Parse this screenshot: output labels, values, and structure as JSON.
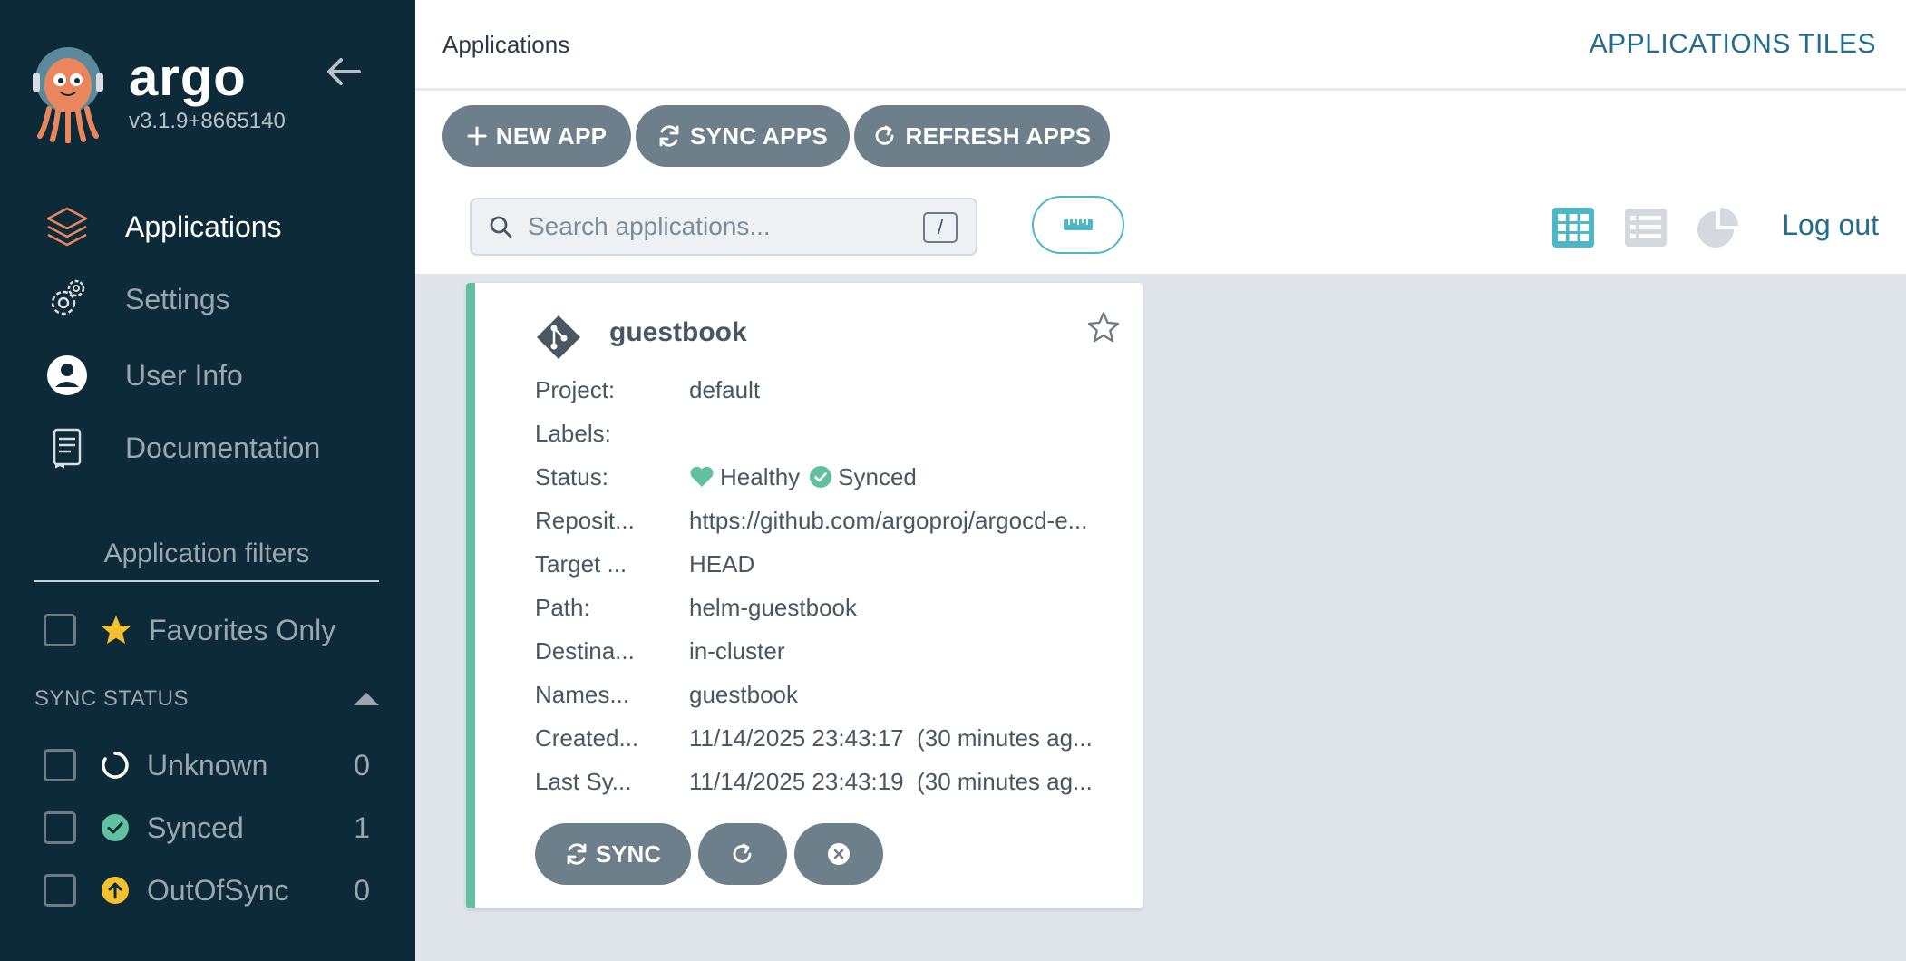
{
  "sidebar": {
    "brand": "argo",
    "version": "v3.1.9+8665140",
    "nav": [
      {
        "label": "Applications",
        "icon": "layers-icon",
        "active": true
      },
      {
        "label": "Settings",
        "icon": "gears-icon",
        "active": false
      },
      {
        "label": "User Info",
        "icon": "user-circle-icon",
        "active": false
      },
      {
        "label": "Documentation",
        "icon": "book-icon",
        "active": false
      }
    ],
    "filters_title": "Application filters",
    "favorites_label": "Favorites Only",
    "sync_status_title": "SYNC STATUS",
    "sync_items": [
      {
        "label": "Unknown",
        "count": "0",
        "icon": "circle-notch-icon"
      },
      {
        "label": "Synced",
        "count": "1",
        "icon": "check-circle-icon"
      },
      {
        "label": "OutOfSync",
        "count": "0",
        "icon": "arrow-up-circle-icon"
      }
    ]
  },
  "header": {
    "title": "Applications",
    "subtitle": "APPLICATIONS TILES"
  },
  "toolbar": {
    "new_app": "NEW APP",
    "sync_apps": "SYNC APPS",
    "refresh_apps": "REFRESH APPS",
    "search_placeholder": "Search applications...",
    "search_shortcut": "/",
    "logout": "Log out"
  },
  "app": {
    "name": "guestbook",
    "fields": [
      {
        "k": "Project:",
        "v": "default"
      },
      {
        "k": "Labels:",
        "v": ""
      },
      {
        "k": "Status:",
        "v": ""
      },
      {
        "k": "Reposit...",
        "v": "https://github.com/argoproj/argocd-e..."
      },
      {
        "k": "Target ...",
        "v": "HEAD"
      },
      {
        "k": "Path:",
        "v": "helm-guestbook"
      },
      {
        "k": "Destina...",
        "v": "in-cluster"
      },
      {
        "k": "Names...",
        "v": "guestbook"
      },
      {
        "k": "Created...",
        "v": "11/14/2025 23:43:17  (30 minutes ag..."
      },
      {
        "k": "Last Sy...",
        "v": "11/14/2025 23:43:19  (30 minutes ag..."
      }
    ],
    "health": "Healthy",
    "sync": "Synced",
    "sync_button": "SYNC"
  },
  "colors": {
    "sidebar_bg": "#0d2a38",
    "accent": "#246c8c",
    "healthy": "#60c0a0",
    "outofsync": "#f4c030",
    "button": "#6d7f8b"
  }
}
